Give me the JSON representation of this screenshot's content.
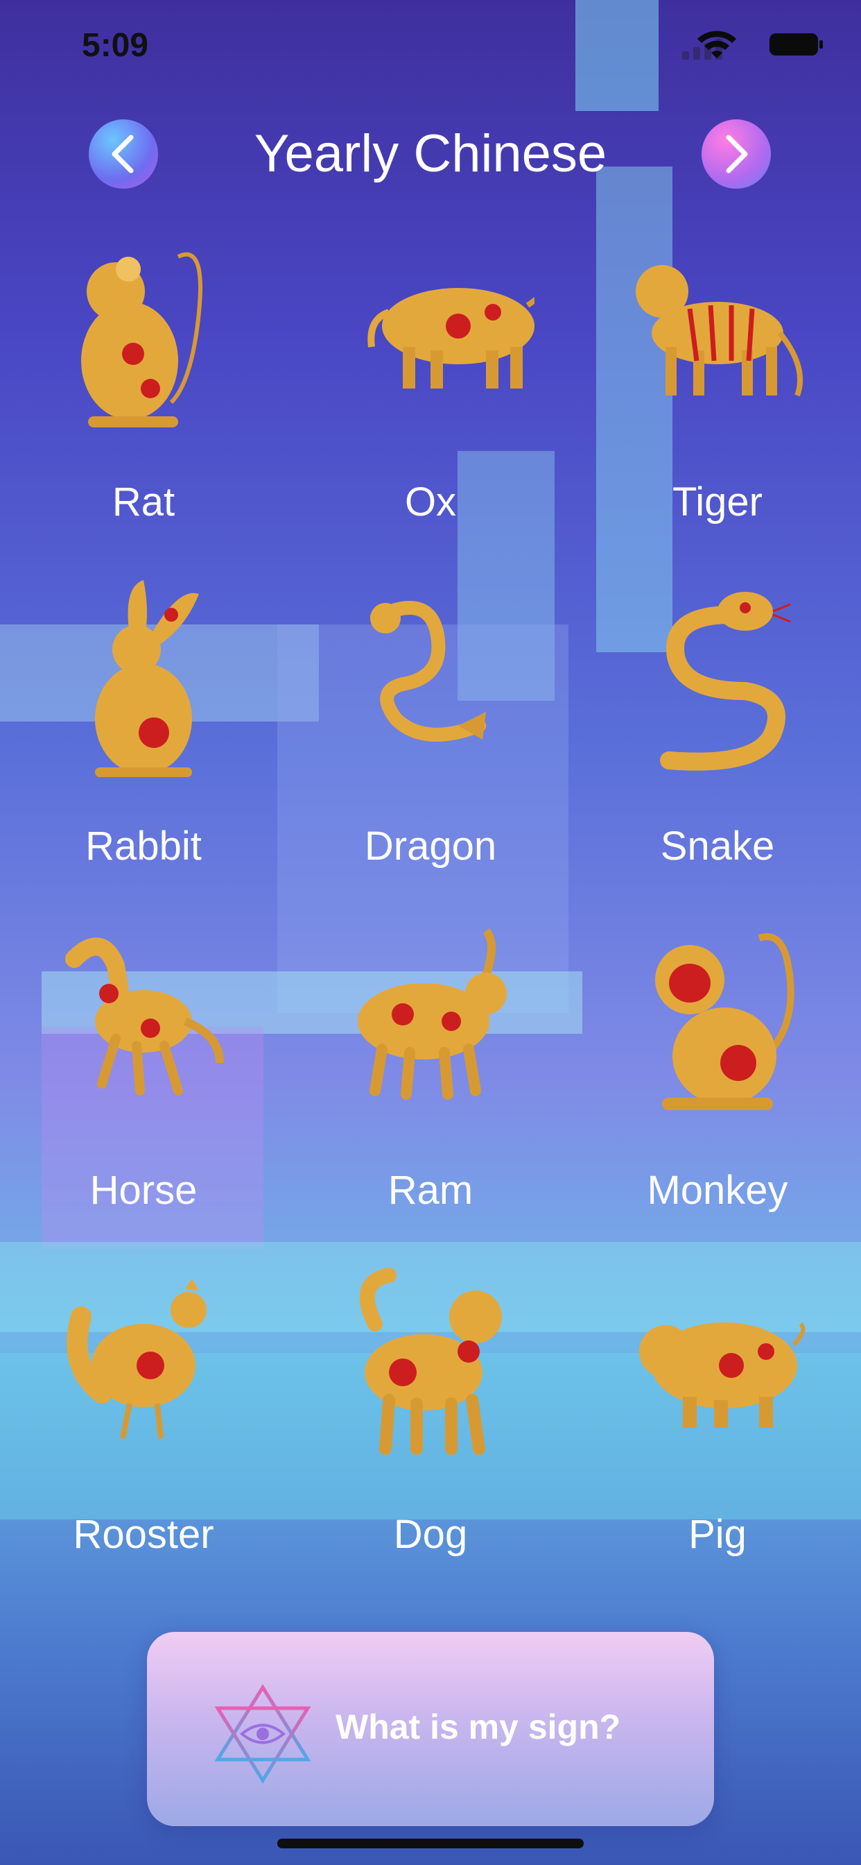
{
  "status_bar": {
    "time": "5:09"
  },
  "header": {
    "title": "Yearly Chinese"
  },
  "colors": {
    "gold": "#e3a83c",
    "red": "#cc1e1e",
    "title_text": "#ffffff"
  },
  "signs": [
    {
      "label": "Rat",
      "icon": "rat-icon"
    },
    {
      "label": "Ox",
      "icon": "ox-icon"
    },
    {
      "label": "Tiger",
      "icon": "tiger-icon"
    },
    {
      "label": "Rabbit",
      "icon": "rabbit-icon"
    },
    {
      "label": "Dragon",
      "icon": "dragon-icon"
    },
    {
      "label": "Snake",
      "icon": "snake-icon"
    },
    {
      "label": "Horse",
      "icon": "horse-icon"
    },
    {
      "label": "Ram",
      "icon": "ram-icon"
    },
    {
      "label": "Monkey",
      "icon": "monkey-icon"
    },
    {
      "label": "Rooster",
      "icon": "rooster-icon"
    },
    {
      "label": "Dog",
      "icon": "dog-icon"
    },
    {
      "label": "Pig",
      "icon": "pig-icon"
    }
  ],
  "cta": {
    "label": "What is my sign?",
    "icon": "star-eye-icon"
  }
}
